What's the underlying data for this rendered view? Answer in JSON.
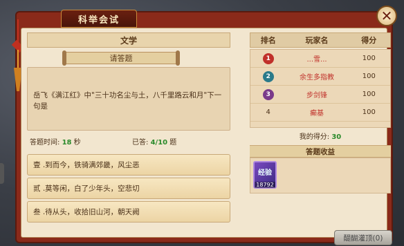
{
  "window": {
    "title": "科举会试"
  },
  "question": {
    "category": "文学",
    "prompt_label": "请答题",
    "text": "岳飞《满江红》中\"三十功名尘与土，八千里路云和月\"下一句是",
    "time_label": "答题时间:",
    "time_value": "18",
    "time_unit": "秒",
    "answered_label": "已答:",
    "answered_value": "4/10",
    "answered_unit": "题"
  },
  "options": [
    {
      "label": "壹 .到而今，铁骑满郊畿，风尘恶"
    },
    {
      "label": "贰 .莫等闲，白了少年头，空悲切"
    },
    {
      "label": "叁 .待从头，收拾旧山河，朝天阙"
    }
  ],
  "ranking": {
    "headers": [
      "排名",
      "玩家名",
      "得分"
    ],
    "rows": [
      {
        "rank": "1",
        "player": "...雪...",
        "score": "100",
        "medal_color": "#c0302a"
      },
      {
        "rank": "2",
        "player": "余生多指教",
        "score": "100",
        "medal_color": "#2a7a8a"
      },
      {
        "rank": "3",
        "player": "步剑锋",
        "score": "100",
        "medal_color": "#7a3a8a"
      },
      {
        "rank": "4",
        "player": "癫基",
        "score": "100",
        "medal_color": ""
      }
    ],
    "my_score_label": "我的得分:",
    "my_score_value": "30"
  },
  "reward": {
    "header": "答题收益",
    "item_label": "经验",
    "item_count": "18792"
  },
  "buttons": {
    "enlighten": "醍醐灌顶(0)",
    "close_icon": "close-icon"
  }
}
